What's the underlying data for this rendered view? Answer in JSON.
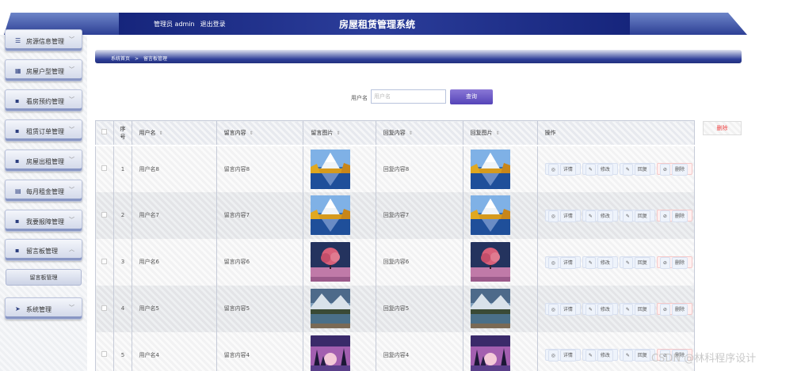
{
  "header": {
    "user_role": "管理员 admin",
    "logout": "退出登录",
    "title": "房屋租赁管理系统"
  },
  "sidebar": {
    "items": [
      {
        "label": "房源信息管理",
        "icon": "list-icon",
        "glyph": "☰"
      },
      {
        "label": "房屋户型管理",
        "icon": "chart-icon",
        "glyph": "▦"
      },
      {
        "label": "看房预约管理",
        "icon": "grid-icon",
        "glyph": "▪"
      },
      {
        "label": "租赁订单管理",
        "icon": "grid-icon",
        "glyph": "▪"
      },
      {
        "label": "房屋出租管理",
        "icon": "grid-icon",
        "glyph": "▪"
      },
      {
        "label": "每月租金管理",
        "icon": "calendar-icon",
        "glyph": "▤"
      },
      {
        "label": "我要报障管理",
        "icon": "grid-icon",
        "glyph": "▪"
      },
      {
        "label": "留言板管理",
        "icon": "grid-icon",
        "glyph": "▪"
      },
      {
        "label": "系统管理",
        "icon": "paper-plane-icon",
        "glyph": "➤"
      }
    ],
    "subitem": "留言板管理"
  },
  "breadcrumb": {
    "home": "系统首页",
    "sep": ">",
    "current": "留言板管理"
  },
  "search": {
    "label": "用户名",
    "placeholder": "用户名",
    "button": "查询"
  },
  "toolbar": {
    "delete": "删除"
  },
  "table": {
    "headers": [
      "",
      "序号",
      "用户名",
      "留言内容",
      "留言图片",
      "回复内容",
      "回复图片",
      "操作"
    ],
    "rows": [
      {
        "no": "1",
        "user": "用户名8",
        "content": "留言内容8",
        "reply": "回复内容8",
        "image": "autumn-lake-mountain"
      },
      {
        "no": "2",
        "user": "用户名7",
        "content": "留言内容7",
        "reply": "回复内容7",
        "image": "autumn-lake-mountain"
      },
      {
        "no": "3",
        "user": "用户名6",
        "content": "留言内容6",
        "reply": "回复内容6",
        "image": "pink-tree-field"
      },
      {
        "no": "4",
        "user": "用户名5",
        "content": "留言内容5",
        "reply": "回复内容5",
        "image": "snowy-mountain-lake"
      },
      {
        "no": "5",
        "user": "用户名4",
        "content": "留言内容4",
        "reply": "回复内容4",
        "image": "purple-sunset-trees"
      }
    ],
    "actions": {
      "detail": "详情",
      "edit": "修改",
      "reply": "回复",
      "delete": "删除"
    }
  },
  "watermark": "CSDN @林科程序设计"
}
